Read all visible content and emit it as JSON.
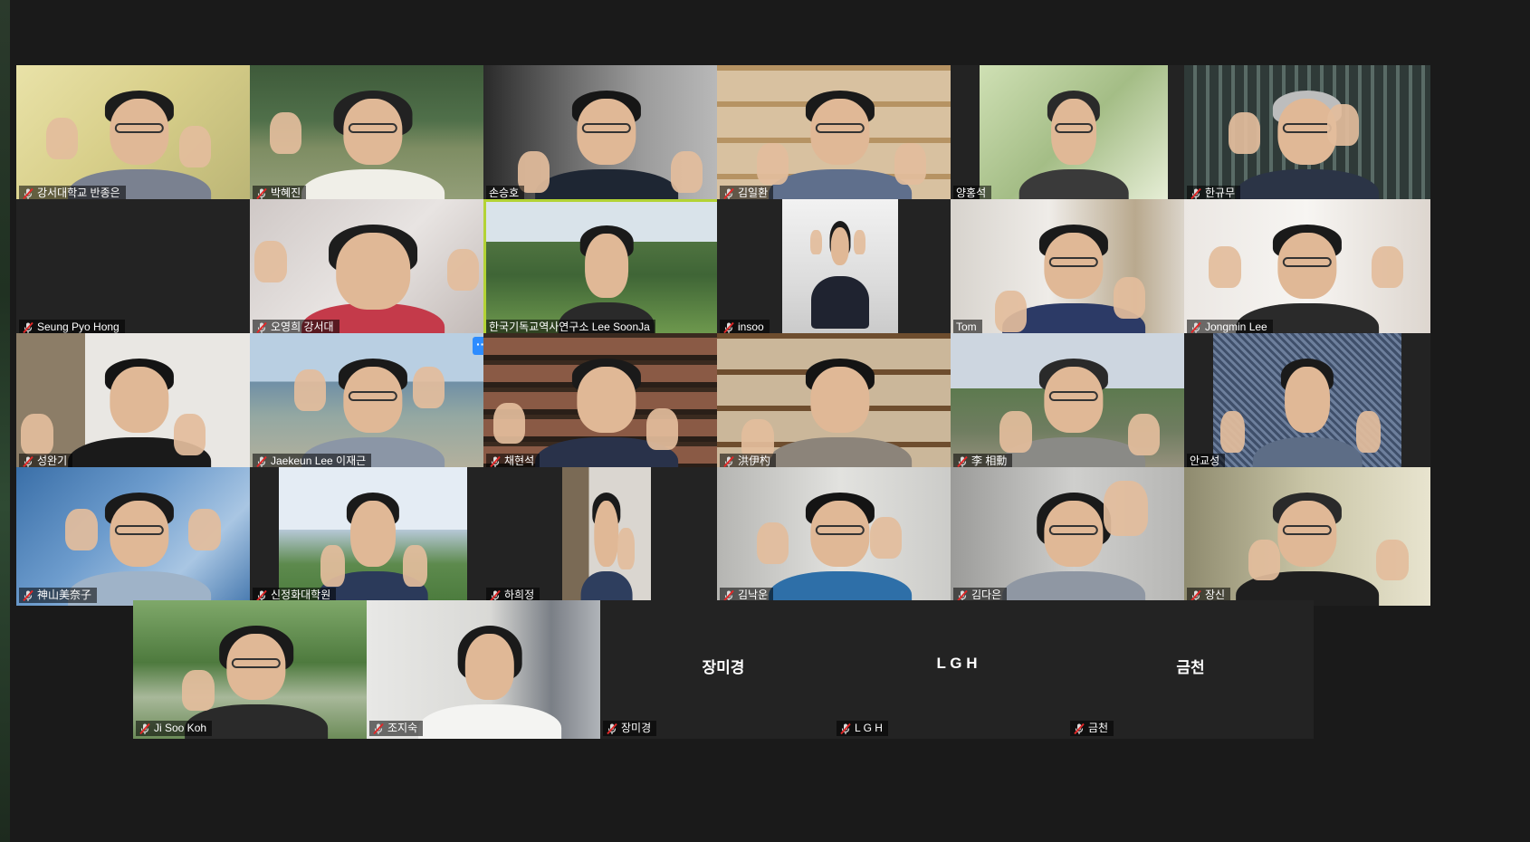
{
  "participants": [
    {
      "name": "강서대학교 반종은",
      "muted": true
    },
    {
      "name": "박혜진",
      "muted": true
    },
    {
      "name": "손승호",
      "muted": false
    },
    {
      "name": "김일환",
      "muted": true
    },
    {
      "name": "양홍석",
      "muted": false
    },
    {
      "name": "한규무",
      "muted": true
    },
    {
      "name": "Seung Pyo Hong",
      "muted": true
    },
    {
      "name": "오영희 강서대",
      "muted": true
    },
    {
      "name": "한국기독교역사연구소 Lee SoonJa",
      "muted": false
    },
    {
      "name": "insoo",
      "muted": true
    },
    {
      "name": "Tom",
      "muted": false
    },
    {
      "name": "Jongmin Lee",
      "muted": true
    },
    {
      "name": "성완기",
      "muted": true
    },
    {
      "name": "Jaekeun Lee 이재근",
      "muted": true
    },
    {
      "name": "채현석",
      "muted": true
    },
    {
      "name": "洪伊杓",
      "muted": true
    },
    {
      "name": "李 相勳",
      "muted": true
    },
    {
      "name": "안교성",
      "muted": false
    },
    {
      "name": "神山美奈子",
      "muted": true
    },
    {
      "name": "신정화대학원",
      "muted": true
    },
    {
      "name": "하희정",
      "muted": true
    },
    {
      "name": "김낙운",
      "muted": true
    },
    {
      "name": "김다은",
      "muted": true
    },
    {
      "name": "장신",
      "muted": true
    },
    {
      "name": "Ji Soo Koh",
      "muted": true
    },
    {
      "name": "조지숙",
      "muted": true
    },
    {
      "name": "장미경",
      "muted": true
    },
    {
      "name": "L G H",
      "muted": true
    },
    {
      "name": "금천",
      "muted": true
    }
  ],
  "no_video_labels": {
    "p27": "장미경",
    "p28": "L G H",
    "p29": "금천"
  },
  "more_button_label": "···",
  "colors": {
    "speaker_border": "#b3d335",
    "mute_red": "#e02828",
    "more_blue": "#2d8cff",
    "background": "#1a1a1a"
  }
}
